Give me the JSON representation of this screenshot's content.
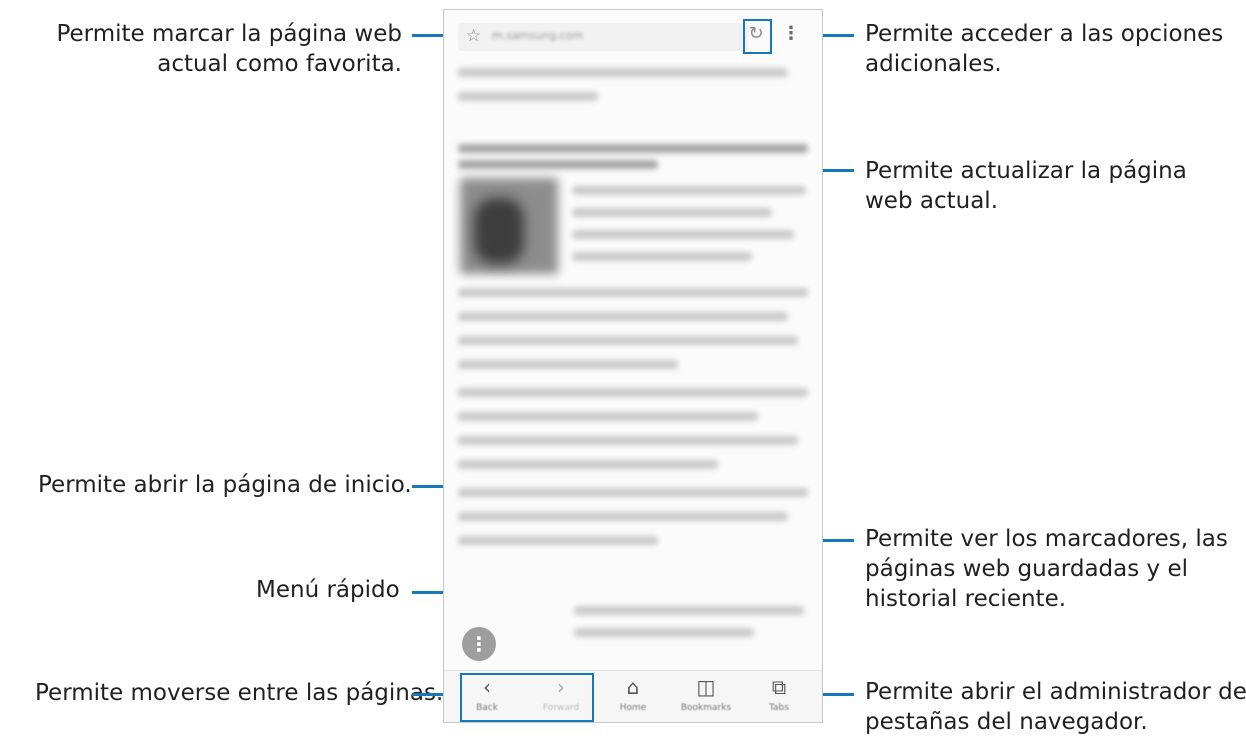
{
  "callouts": {
    "bookmark": "Permite marcar la página web\nactual como favorita.",
    "more_options": "Permite acceder a las opciones\nadicionales.",
    "refresh": "Permite actualizar la página\nweb actual.",
    "home": "Permite abrir la página de inicio.",
    "bookmarks": "Permite ver los marcadores, las\npáginas web guardadas y el\nhistorial reciente.",
    "quick_menu": "Menú rápido",
    "navigate": "Permite moverse entre las páginas.",
    "tabs": "Permite abrir el administrador de\npestañas del navegador."
  },
  "browser": {
    "url": "m.samsung.com",
    "bottom_nav": [
      {
        "label": "Back",
        "icon": "chevron-left-icon",
        "glyph": "‹"
      },
      {
        "label": "Forward",
        "icon": "chevron-right-icon",
        "glyph": "›"
      },
      {
        "label": "Home",
        "icon": "home-icon",
        "glyph": "⌂"
      },
      {
        "label": "Bookmarks",
        "icon": "bookmarks-icon",
        "glyph": "◫"
      },
      {
        "label": "Tabs",
        "icon": "tabs-icon",
        "glyph": "⧉"
      }
    ]
  },
  "colors": {
    "callout_line": "#1478b9",
    "text": "#231f20"
  }
}
